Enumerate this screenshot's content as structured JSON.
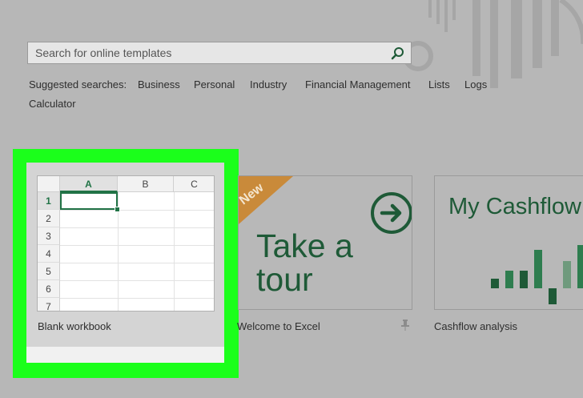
{
  "search": {
    "placeholder": "Search for online templates",
    "icon": "search-icon"
  },
  "suggested": {
    "label": "Suggested searches:",
    "items": [
      "Business",
      "Personal",
      "Industry",
      "Financial Management",
      "Lists",
      "Logs",
      "Calculator"
    ]
  },
  "templates": [
    {
      "name": "Blank workbook",
      "sheet": {
        "columns": [
          "A",
          "B",
          "C"
        ],
        "rows": [
          "1",
          "2",
          "3",
          "4",
          "5",
          "6",
          "7"
        ],
        "selected_cell": "A1"
      }
    },
    {
      "name": "Welcome to Excel",
      "badge": "New",
      "title_line1": "Take a",
      "title_line2": "tour",
      "icon": "arrow-right-circle-icon",
      "pin_icon": "pin-icon"
    },
    {
      "name": "Cashflow analysis",
      "title": "My Cashflow"
    }
  ],
  "colors": {
    "accent": "#217346",
    "dark_green": "#1e5a37",
    "highlight": "#1bff1b",
    "badge": "#c98a3a",
    "background": "#b7b7b7"
  }
}
